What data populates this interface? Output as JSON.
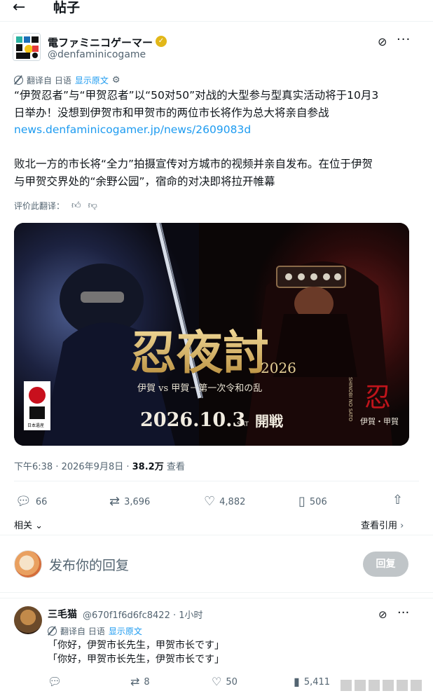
{
  "header": {
    "title": "帖子"
  },
  "author": {
    "name": "電ファミニコゲーマー",
    "handle": "@denfaminicogame"
  },
  "translate_bar": {
    "from_label": "翻译自 日语",
    "show_original": "显示原文"
  },
  "tweet": {
    "line1": "“伊贺忍者”与“甲贺忍者”以“50对50”对战的大型参与型真实活动将于10月3",
    "line2": "日举办！没想到伊贺市和甲贺市的两位市长将作为总大将亲自参战",
    "link": "news.denfaminicogamer.jp/news/2609083d",
    "line3": "败北一方的市长将“全力”拍摄宣传对方城市的视频并亲自发布。在位于伊贺",
    "line4": "与甲贺交界处的“余野公园”，宿命的对决即将拉开帷幕"
  },
  "rate_translation": "评价此翻译：",
  "poster": {
    "title": "忍夜討",
    "year": "2026",
    "subtitle": "伊賀 vs 甲賀－第一次令和の乱",
    "date": "2026.10.3",
    "weekday": "SAT",
    "kaisen": "開戦",
    "emblem_glyph": "忍",
    "emblem_text": "伊賀・甲賀",
    "left_logo_text": "日本遺産",
    "side_text": "SHINOBI NO SATO"
  },
  "meta": {
    "time": "下午6:38 · 2026年9月8日 · ",
    "views": "38.2万",
    "views_label": " 查看"
  },
  "actions": {
    "replies": "66",
    "retweets": "3,696",
    "likes": "4,882",
    "bookmarks": "506"
  },
  "related_label": "相关",
  "view_quotes": "查看引用",
  "composer": {
    "placeholder": "发布你的回复",
    "button": "回复"
  },
  "comment": {
    "name": "三毛猫",
    "handle": "@670f1f6d6fc8422 · 1小时",
    "translate_from": "翻译自 日语",
    "show_original": "显示原文",
    "line1": "「你好，伊贺市长先生，甲贺市长です」",
    "line2": "「你好，甲贺市长先生，伊贺市长です」",
    "replies": "",
    "retweets": "8",
    "likes": "50",
    "views": "5,411"
  },
  "colors": {
    "link": "#1d9bf0",
    "muted": "#536471",
    "poster_gold": "#d9b86a",
    "poster_red": "#b0161a"
  },
  "icons": [
    "back-arrow-icon",
    "verified-badge-icon",
    "grok-icon",
    "more-icon",
    "translate-icon",
    "settings-icon",
    "thumbs-up-icon",
    "thumbs-down-icon",
    "reply-icon",
    "retweet-icon",
    "like-icon",
    "bookmark-icon",
    "share-icon",
    "chevron-down-icon",
    "chevron-right-icon",
    "views-icon"
  ]
}
